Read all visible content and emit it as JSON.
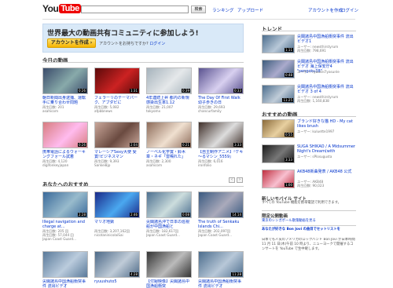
{
  "header": {
    "logo_you": "You",
    "logo_tube": "Tube",
    "search_button": "検索",
    "links": [
      "ランキング",
      "アップロード"
    ],
    "create_account": "アカウントを作成",
    "login": "ログイン"
  },
  "banner": {
    "title": "世界最大の動画共有コミュニティに参加しよう!",
    "button": "アカウントを作成 ›",
    "have_account": "アカウントをお持ちですか?",
    "login": "ログイン"
  },
  "today": {
    "heading": "今日の動画",
    "items": [
      {
        "title": "朝日新聞出身逮捕、運転手に乗り合わせ問題",
        "meta1": "再生回数: 201",
        "meta2": "asahicom",
        "dur": "0:26",
        "c": [
          "#3b4c6b",
          "#8aa"
        ]
      },
      {
        "title": "フェラーリのテーマパーク、アブダビに",
        "meta1": "再生回数: 5,082",
        "meta2": "afpbbnews",
        "dur": "1:31",
        "c": [
          "#5b0a0a",
          "#c22"
        ]
      },
      {
        "title": "4年連続上昇 都内の新規感染出生率1.12",
        "meta1": "再生回数: 21,007",
        "meta2": "tokyomx",
        "dur": "0:39",
        "c": [
          "#a6b3bc",
          "#e5e8ea"
        ]
      },
      {
        "title": "The Day Of First Walk 幼子歩きの日",
        "meta1": "再生回数: 29,693",
        "meta2": "chancurfamily",
        "dur": "0:33",
        "c": [
          "#5a5290",
          "#d8d0f0"
        ]
      },
      {
        "title": "携帯電話によるウォーキングフォール試着",
        "meta1": "再生回数: 4,120",
        "meta2": "digifonkeyjapan",
        "dur": "0:26",
        "c": [
          "#d87d80",
          "#fbe"
        ]
      },
      {
        "title": "マレーシアSexy大使 受賞!ビジネスマン",
        "meta1": "再生回数: 9,393",
        "meta2": "Sankei8jp",
        "dur": "2:04",
        "c": [
          "#c9a79a",
          "#6a4a40"
        ]
      },
      {
        "title": "ノーベル化学賞・鈴木章・ネギ「雷鳴れた」",
        "meta1": "再生回数: 2,300",
        "meta2": "asahicom",
        "dur": "0:21",
        "c": [
          "#8e6c5a",
          "#f0e0d0"
        ]
      },
      {
        "title": "【自主制作アニメ】『ケキ～るマシン_5559』",
        "meta1": "再生回数: 6,016",
        "meta2": "ironfolio",
        "dur": "3:33",
        "c": [
          "#40302a",
          "#ddd"
        ]
      }
    ]
  },
  "recommend": {
    "heading": "あなたへのおすすめ",
    "items": [
      {
        "title": "Illegal navigation and charge at...",
        "meta1": "再生回数: 205 回",
        "meta2": "再生回数: 57,044 回",
        "meta3": "Japan Coast Guard...",
        "dur": "2:28",
        "c": [
          "#3a6a9b",
          "#9bc"
        ]
      },
      {
        "title": "マリオ地獄",
        "meta1": "再生回数: 3,207,162回",
        "meta2": "nicotaninicolaiSai",
        "meta3": "",
        "dur": "2:46",
        "c": [
          "#1a2a8a",
          "#4aa8f0"
        ]
      },
      {
        "title": "尖閣諸島沖で日本の巡視船が中国漁船と",
        "meta1": "再生回数: 182,617回",
        "meta2": "Japan Coast Guard...",
        "meta3": "",
        "dur": "0:08",
        "c": [
          "#4d7090",
          "#cdd"
        ]
      },
      {
        "title": "The truth of Senkaku Islands Chi...",
        "meta1": "再生回数: 202,097回",
        "meta2": "Japan Coast Guard...",
        "meta3": "",
        "dur": "14:14",
        "c": [
          "#3a5a80",
          "#aab"
        ]
      },
      {
        "title": "尖閣諸島中国漁船衝突事件 流出ビデオ",
        "meta1": "",
        "meta2": "",
        "meta3": "",
        "dur": "",
        "c": [
          "#5a7a9a",
          "#bcd"
        ]
      },
      {
        "title": "ryuushuto5",
        "meta1": "",
        "meta2": "",
        "meta3": "",
        "dur": "4:28",
        "c": [
          "#4d6a88",
          "#c0ccd8"
        ]
      },
      {
        "title": "【付録映像】尖閣諸島中国漁船衝突",
        "meta1": "",
        "meta2": "",
        "meta3": "",
        "dur": "",
        "c": [
          "#333",
          "#bbb"
        ]
      },
      {
        "title": "尖閣諸島中国漁船衝突事件 流出ビデオ",
        "meta1": "",
        "meta2": "",
        "meta3": "",
        "dur": "11:28",
        "c": [
          "#4c6d8d",
          "#b8c8d8"
        ]
      }
    ]
  },
  "trend": {
    "heading": "トレンド",
    "items": [
      {
        "title": "尖閣諸島中国漁船衝突事件 流出ビデオ1",
        "meta1": "ユーザー: newsthirstyrum",
        "meta2": "再生回数: 798,691",
        "dur": "1:11",
        "c": [
          "#4c6d8d",
          "#b8c8d8"
        ]
      },
      {
        "title": "尖閣諸島中国漁船衝突事件 流出ビデオ 海上保安庁4 \"sengoku38\"",
        "meta1": "ユーザー: ryuusei7yasunle",
        "meta2": "",
        "dur": "0:48",
        "c": [
          "#3e5d7d",
          "#aac"
        ]
      },
      {
        "title": "尖閣諸島中国漁船衝突事件 流出ビデオ 3 of 4",
        "meta1": "ユーザー: newsthirstyrum",
        "meta2": "再生回数: 1,160,838",
        "dur": "11:25",
        "c": [
          "#4c6d8d",
          "#c0ccd8"
        ]
      }
    ]
  },
  "recvids": {
    "heading": "おすすめの動画",
    "items": [
      {
        "title": "ブランド好きな猫 HD - My cat likes brush",
        "meta1": "ユーザー: kuluette1997",
        "meta2": "",
        "dur": "0:55",
        "c": [
          "#8a6a3a",
          "#e8d0a0"
        ]
      },
      {
        "title": "SUGA SHIKAO / A Midsummer Night's Dream(with",
        "meta1": "ユーザー: sPlosugusta",
        "meta2": "",
        "dur": "3:33",
        "c": [
          "#1a1a1a",
          "#777"
        ]
      },
      {
        "title": "AKB48新曲発表 / AKB48 公式",
        "meta1": "ユーザー: AKB48",
        "meta2": "再生回数: 90,023",
        "dur": "1:00",
        "c": [
          "#c03040",
          "#f8c0d0"
        ]
      }
    ]
  },
  "mobile": {
    "heading": "新しいモバイル サイト",
    "text": "すべての YouTube 機能を携帯電話で利用できます。"
  },
  "limited": {
    "heading": "限定公開動画",
    "link": "東京のシンガポール散策動画を見る",
    "bold": "あなたが好きな Bon Jovi の曲目でセットリストを",
    "text": "日本でも人気のアメリカのロックバンド Bon Jovi が日本時間 11 月 11 日(木)午前 10 時より、ニューヨークで開催するコンサートを YouTube で生中継します。"
  }
}
